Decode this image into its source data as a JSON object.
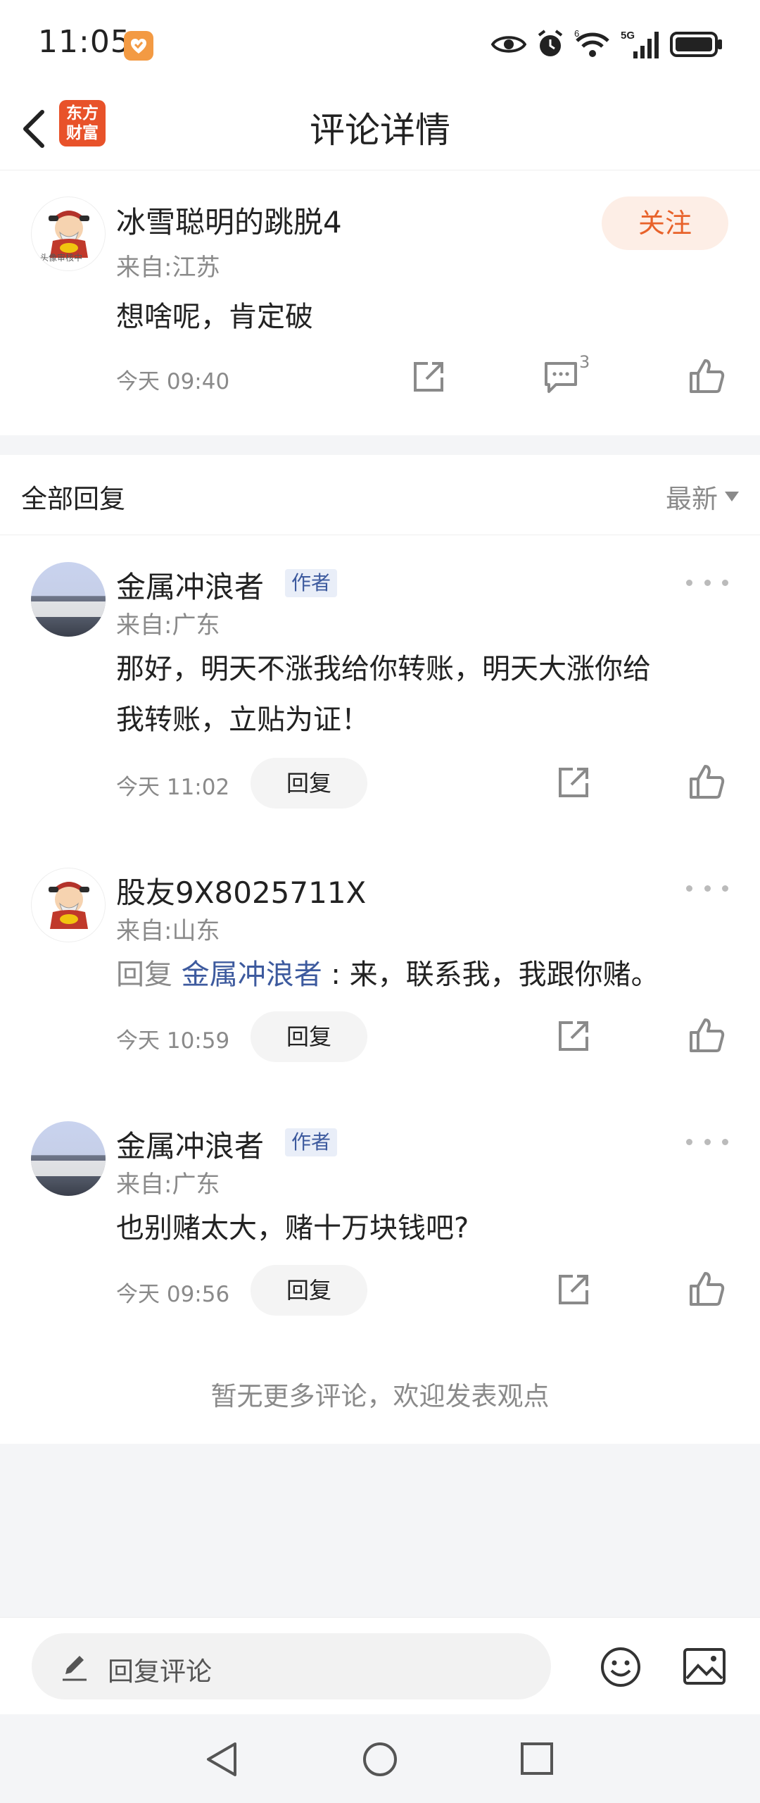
{
  "status_bar": {
    "time": "11:05",
    "network_label": "5G",
    "wifi_label": "6"
  },
  "header": {
    "title": "评论详情",
    "logo_line1": "东方",
    "logo_line2": "财富",
    "back_icon": "chevron-left-icon"
  },
  "main_comment": {
    "username": "冰雪聪明的跳脱4",
    "location": "来自:江苏",
    "text": "想啥呢，肯定破",
    "time": "今天 09:40",
    "follow_label": "关注",
    "comment_count": "3",
    "avatar_caption": "头像审核中"
  },
  "replies_section": {
    "title": "全部回复",
    "sort_label": "最新"
  },
  "replies": [
    {
      "username": "金属冲浪者",
      "badge": "作者",
      "location": "来自:广东",
      "text_line1": "那好，明天不涨我给你转账，明天大涨你给",
      "text_line2": "我转账，立贴为证！",
      "time": "今天 11:02",
      "reply_label": "回复"
    },
    {
      "username": "股友9X8025711X",
      "location": "来自:山东",
      "reply_prefix": "回复 ",
      "mention": "金属冲浪者",
      "text": " : 来，联系我，我跟你赌。",
      "time": "今天 10:59",
      "reply_label": "回复"
    },
    {
      "username": "金属冲浪者",
      "badge": "作者",
      "location": "来自:广东",
      "text": "也别赌太大，赌十万块钱吧?",
      "time": "今天 09:56",
      "reply_label": "回复"
    }
  ],
  "no_more_text": "暂无更多评论，欢迎发表观点",
  "input_bar": {
    "placeholder": "回复评论"
  },
  "colors": {
    "accent": "#e8622a",
    "link": "#3d5a9e",
    "muted": "#8a8a8a"
  }
}
